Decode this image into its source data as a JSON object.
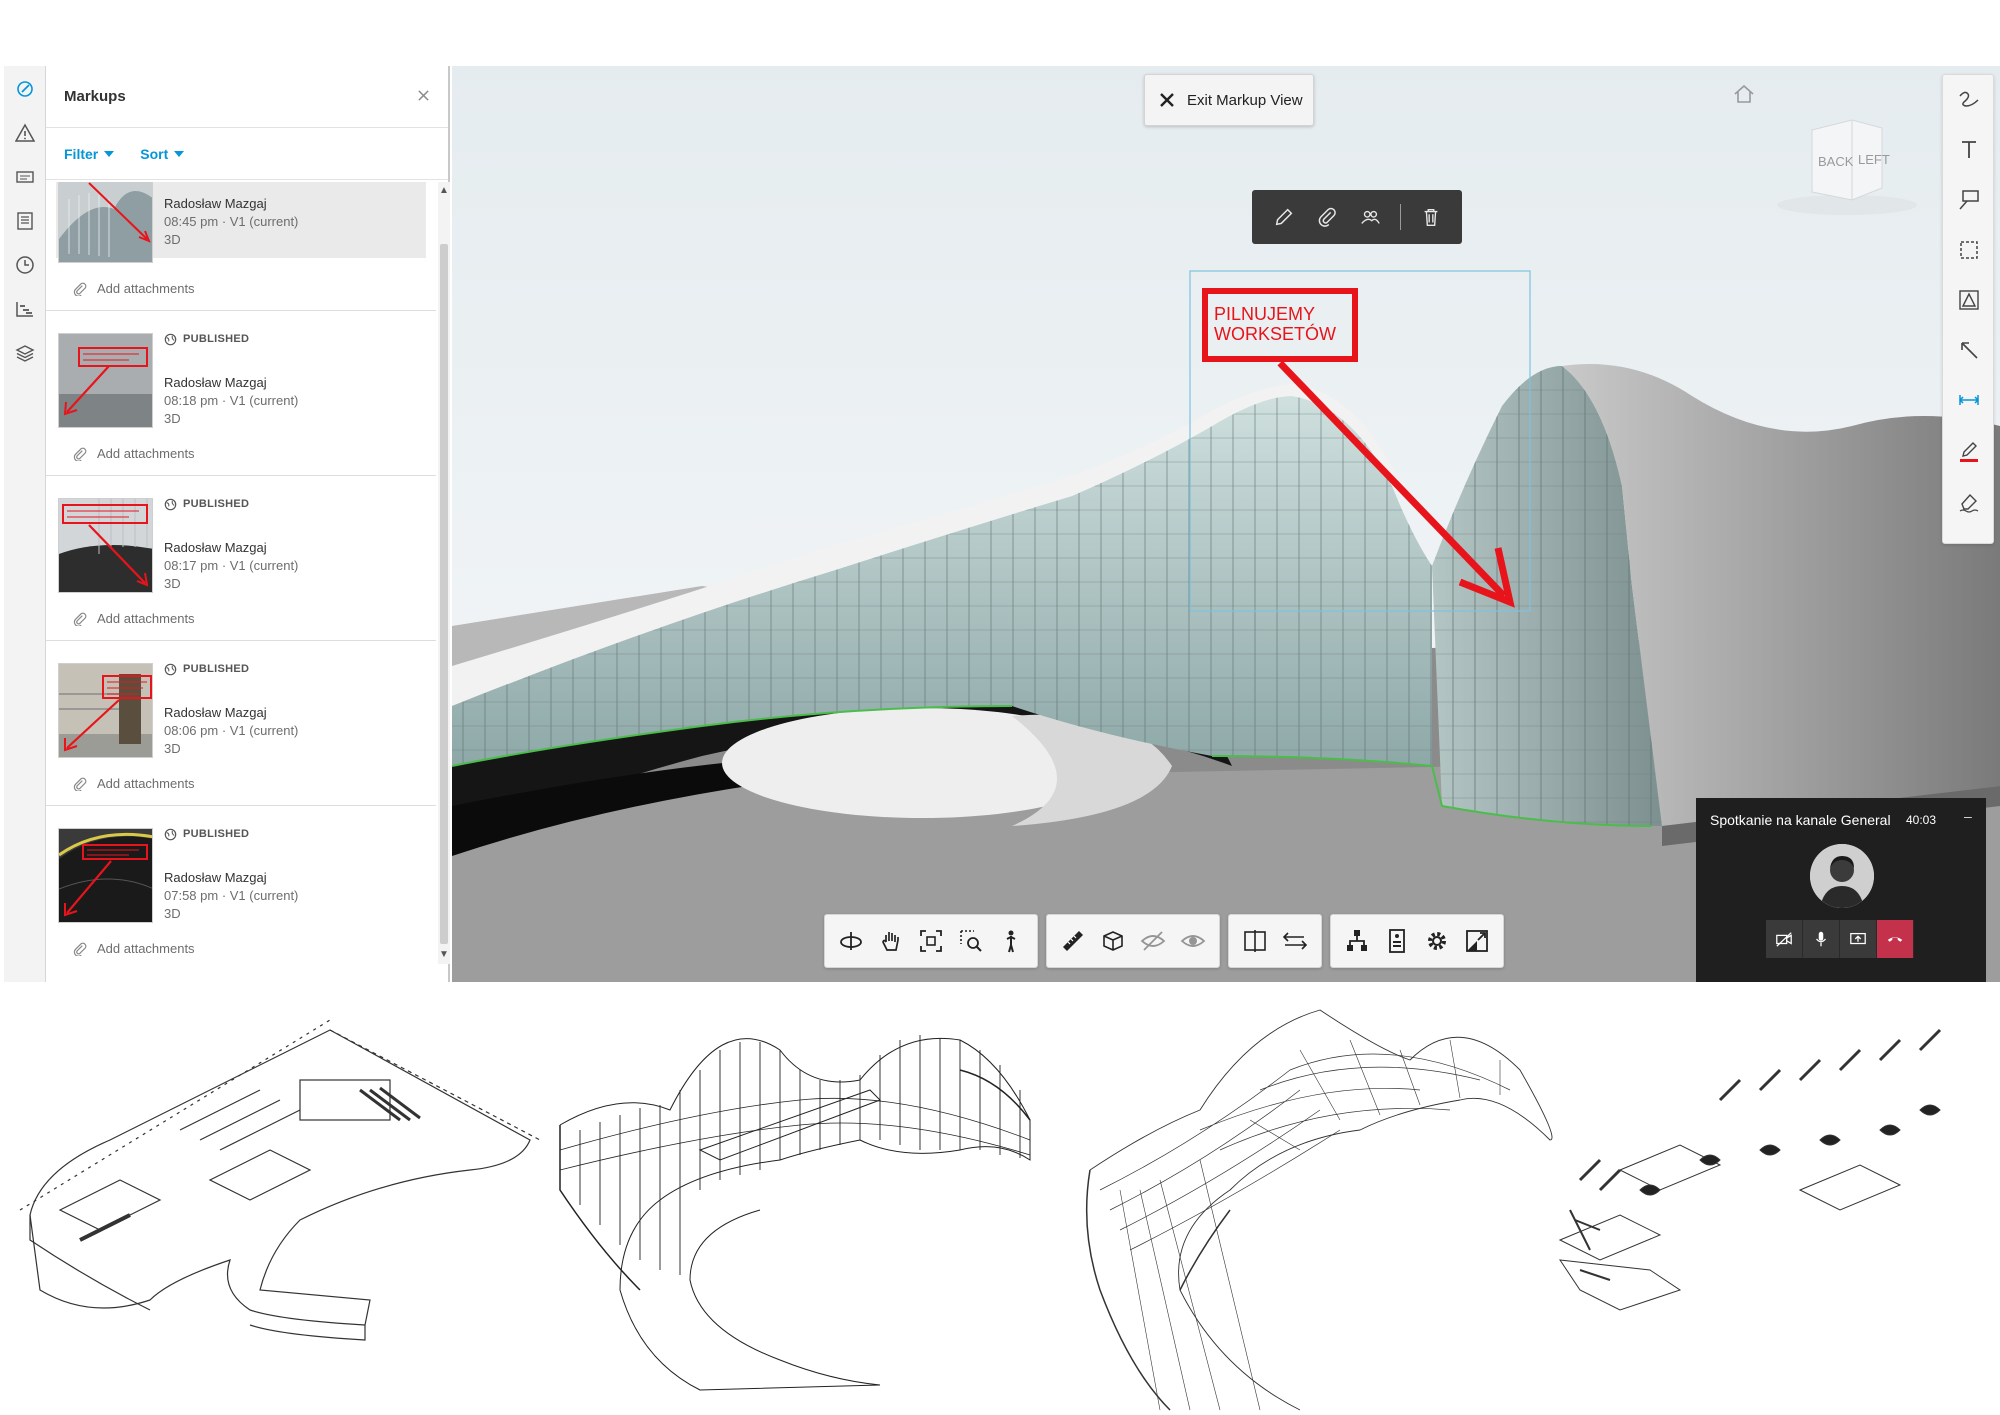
{
  "rail": {
    "icons": [
      "markup-icon",
      "issues-icon",
      "rfi-icon",
      "sheets-icon",
      "history-icon",
      "model-browser-icon",
      "layers-icon"
    ]
  },
  "panel": {
    "title": "Markups",
    "filter_label": "Filter",
    "sort_label": "Sort",
    "items": [
      {
        "status": "",
        "author": "Radosław Mazgaj",
        "meta": "08:45 pm  ·  V1 (current)",
        "type": "3D",
        "attach_label": "Add attachments"
      },
      {
        "status": "PUBLISHED",
        "author": "Radosław Mazgaj",
        "meta": "08:18 pm  ·  V1 (current)",
        "type": "3D",
        "attach_label": "Add attachments"
      },
      {
        "status": "PUBLISHED",
        "author": "Radosław Mazgaj",
        "meta": "08:17 pm  ·  V1 (current)",
        "type": "3D",
        "attach_label": "Add attachments"
      },
      {
        "status": "PUBLISHED",
        "author": "Radosław Mazgaj",
        "meta": "08:06 pm  ·  V1 (current)",
        "type": "3D",
        "attach_label": "Add attachments"
      },
      {
        "status": "PUBLISHED",
        "author": "Radosław Mazgaj",
        "meta": "07:58 pm  ·  V1 (current)",
        "type": "3D",
        "attach_label": "Add attachments"
      }
    ]
  },
  "viewer": {
    "exit_label": "Exit Markup View",
    "markup_text_line1": "PILNUJEMY",
    "markup_text_line2": "WORKSETÓW",
    "viewcube_back": "BACK",
    "viewcube_left": "LEFT",
    "markup_color": "#e8141b",
    "selection_color": "#7cc3e0"
  },
  "markup_toolbar": {
    "icons": [
      "edit-icon",
      "attachment-icon",
      "visibility-icon",
      "trash-icon"
    ]
  },
  "right_tools": {
    "icons": [
      "freehand-icon",
      "text-icon",
      "callout-icon",
      "cloud-icon",
      "polycloud-icon",
      "arrow-icon",
      "dimension-icon",
      "pen-color-icon",
      "highlighter-icon"
    ]
  },
  "nav_toolbar": {
    "groups": [
      [
        "orbit-icon",
        "pan-icon",
        "fit-to-view-icon",
        "zoom-window-icon",
        "first-person-icon"
      ],
      [
        "measure-icon",
        "section-box-icon",
        "hide-icon",
        "isolate-icon"
      ],
      [
        "compare-icon",
        "swap-icon"
      ],
      [
        "model-tree-icon",
        "properties-icon",
        "settings-icon",
        "fullscreen-icon"
      ]
    ]
  },
  "teams": {
    "title": "Spotkanie na kanale General",
    "time": "40:03",
    "minimize": "–",
    "controls": [
      "camera-off-icon",
      "microphone-icon",
      "share-screen-icon",
      "hang-up-icon"
    ],
    "hangup_color": "#c4314b"
  }
}
